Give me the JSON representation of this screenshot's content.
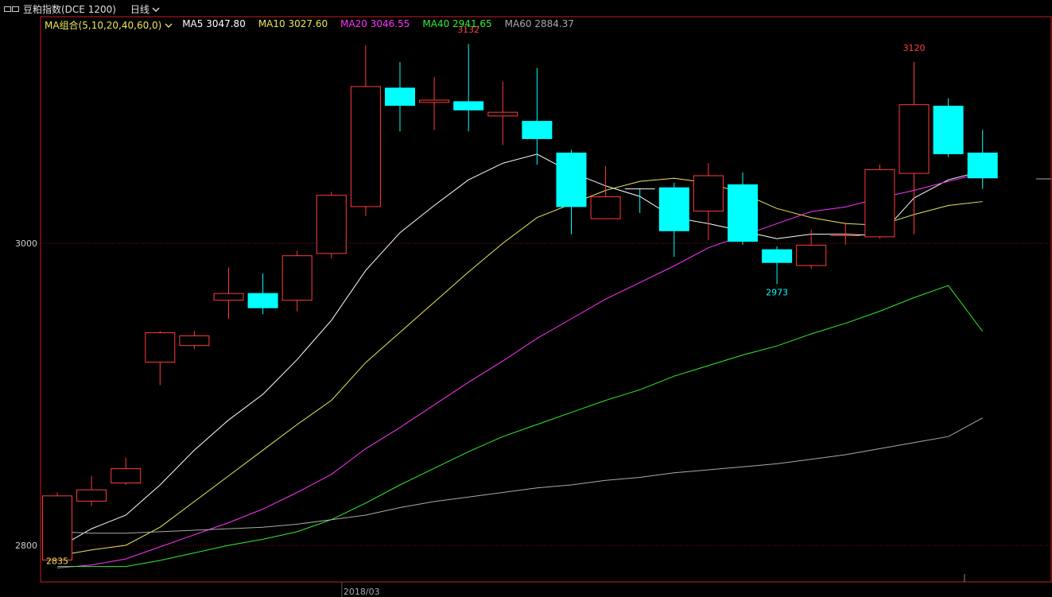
{
  "header": {
    "symbol": "豆粕指数(DCE 1200)",
    "period": "日线"
  },
  "ma_bar": {
    "combo": "MA组合(5,10,20,40,60,0)",
    "items": [
      {
        "label": "MA5 3047.80",
        "color": "#ffffff"
      },
      {
        "label": "MA10 3027.60",
        "color": "#e8e85a"
      },
      {
        "label": "MA20 3046.55",
        "color": "#ff33ff"
      },
      {
        "label": "MA40 2941.65",
        "color": "#33ee33"
      },
      {
        "label": "MA60 2884.37",
        "color": "#aaaaaa"
      }
    ]
  },
  "colors": {
    "up": "#ff3b3b",
    "down": "#00ffff",
    "frame": "#c81e1e",
    "grid": "#7a1a1a",
    "ma5": "#ffffff",
    "ma10": "#e8e85a",
    "ma20": "#ff33ff",
    "ma40": "#33ee33",
    "ma60": "#aaaaaa"
  },
  "chart_data": {
    "type": "candlestick",
    "y_ticks": [
      "3000",
      "2800"
    ],
    "x_tick": "2018/03",
    "x_tick_index": 9,
    "annotations": [
      {
        "text": "3132",
        "index": 12,
        "value": 3132,
        "position": "above"
      },
      {
        "text": "3120",
        "index": 25,
        "value": 3120,
        "position": "above"
      },
      {
        "text": "2973",
        "index": 21,
        "value": 2973,
        "position": "below"
      },
      {
        "text": "2835",
        "index": 0,
        "value": 2795,
        "position": "below"
      }
    ],
    "candles": [
      {
        "o": 2790,
        "h": 2835,
        "l": 2790,
        "c": 2833
      },
      {
        "o": 2829,
        "h": 2846,
        "l": 2826,
        "c": 2837
      },
      {
        "o": 2841,
        "h": 2858,
        "l": 2840,
        "c": 2851
      },
      {
        "o": 2921,
        "h": 2942,
        "l": 2906,
        "c": 2941
      },
      {
        "o": 2932,
        "h": 2942,
        "l": 2930,
        "c": 2939
      },
      {
        "o": 2962,
        "h": 2984,
        "l": 2950,
        "c": 2967
      },
      {
        "o": 2967,
        "h": 2980,
        "l": 2953,
        "c": 2957
      },
      {
        "o": 2962,
        "h": 2995,
        "l": 2955,
        "c": 2992
      },
      {
        "o": 2993,
        "h": 3034,
        "l": 2990,
        "c": 3032
      },
      {
        "o": 3024,
        "h": 3131,
        "l": 3018,
        "c": 3104
      },
      {
        "o": 3103,
        "h": 3120,
        "l": 3074,
        "c": 3091
      },
      {
        "o": 3093,
        "h": 3110,
        "l": 3075,
        "c": 3095
      },
      {
        "o": 3094,
        "h": 3132,
        "l": 3074,
        "c": 3088
      },
      {
        "o": 3084,
        "h": 3107,
        "l": 3065,
        "c": 3087
      },
      {
        "o": 3081,
        "h": 3116,
        "l": 3052,
        "c": 3069
      },
      {
        "o": 3060,
        "h": 3062,
        "l": 3006,
        "c": 3024
      },
      {
        "o": 3016,
        "h": 3051,
        "l": 3016,
        "c": 3031
      },
      {
        "o": 3036,
        "h": 3036,
        "l": 3020,
        "c": 3035
      },
      {
        "o": 3037,
        "h": 3040,
        "l": 2991,
        "c": 3008
      },
      {
        "o": 3021,
        "h": 3053,
        "l": 3002,
        "c": 3045
      },
      {
        "o": 3039,
        "h": 3047,
        "l": 2999,
        "c": 3001
      },
      {
        "o": 2996,
        "h": 2998,
        "l": 2973,
        "c": 2987
      },
      {
        "o": 2985,
        "h": 3009,
        "l": 2983,
        "c": 2999
      },
      {
        "o": 3005,
        "h": 3014,
        "l": 2999,
        "c": 3005
      },
      {
        "o": 3004,
        "h": 3052,
        "l": 3003,
        "c": 3049
      },
      {
        "o": 3046,
        "h": 3120,
        "l": 3006,
        "c": 3092
      },
      {
        "o": 3091,
        "h": 3096,
        "l": 3057,
        "c": 3059
      },
      {
        "o": 3060,
        "h": 3075,
        "l": 3036,
        "c": 3043
      }
    ],
    "ma": {
      "ma5": [
        2798,
        2811,
        2820,
        2840,
        2863,
        2883,
        2900,
        2923,
        2949,
        2982,
        3007,
        3025,
        3042,
        3053,
        3059,
        3047,
        3038,
        3031,
        3017,
        3013,
        3008,
        3003,
        3006,
        3006,
        3005,
        3030,
        3042,
        3047.8
      ],
      "ma10": [
        2793,
        2797,
        2800,
        2812,
        2829,
        2846,
        2863,
        2880,
        2896,
        2921,
        2941,
        2961,
        2981,
        3000,
        3017,
        3026,
        3035,
        3041,
        3043,
        3040,
        3033,
        3023,
        3017,
        3013,
        3012,
        3019,
        3025,
        3027.6
      ],
      "ma20": [
        2785,
        2787,
        2791,
        2799,
        2807,
        2815,
        2824,
        2835,
        2847,
        2864,
        2878,
        2893,
        2908,
        2922,
        2937,
        2950,
        2963,
        2974,
        2985,
        2997,
        3005,
        3013,
        3021,
        3024,
        3030,
        3035,
        3041,
        3046.55
      ],
      "ma40": [
        2786,
        2786,
        2786,
        2790,
        2795,
        2800,
        2804,
        2809,
        2817,
        2828,
        2840,
        2851,
        2862,
        2872,
        2880,
        2888,
        2896,
        2903,
        2912,
        2919,
        2926,
        2932,
        2940,
        2947,
        2955,
        2964,
        2972,
        2941.65
      ],
      "ma60": [
        2809,
        2808,
        2808,
        2809,
        2810,
        2811,
        2812,
        2814,
        2817,
        2820,
        2825,
        2829,
        2832,
        2835,
        2838,
        2840,
        2843,
        2845,
        2848,
        2850,
        2852,
        2854,
        2857,
        2860,
        2864,
        2868,
        2872,
        2884.37
      ]
    },
    "ylim": [
      2790,
      3145
    ]
  }
}
